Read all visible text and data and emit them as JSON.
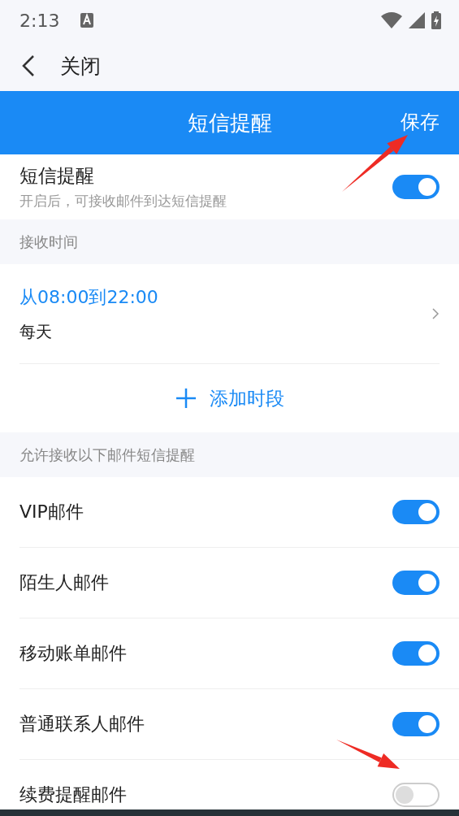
{
  "status_bar": {
    "time": "2:13"
  },
  "nav": {
    "close_label": "关闭"
  },
  "header": {
    "title": "短信提醒",
    "save": "保存"
  },
  "sms_toggle": {
    "title": "短信提醒",
    "subtitle": "开启后，可接收邮件到达短信提醒",
    "on": true
  },
  "receive_time": {
    "section_label": "接收时间",
    "range": "从08:00到22:00",
    "repeat": "每天",
    "add_label": "添加时段"
  },
  "mail_types": {
    "section_label": "允许接收以下邮件短信提醒",
    "items": [
      {
        "label": "VIP邮件",
        "on": true
      },
      {
        "label": "陌生人邮件",
        "on": true
      },
      {
        "label": "移动账单邮件",
        "on": true
      },
      {
        "label": "普通联系人邮件",
        "on": true
      },
      {
        "label": "续费提醒邮件",
        "on": false
      }
    ]
  }
}
